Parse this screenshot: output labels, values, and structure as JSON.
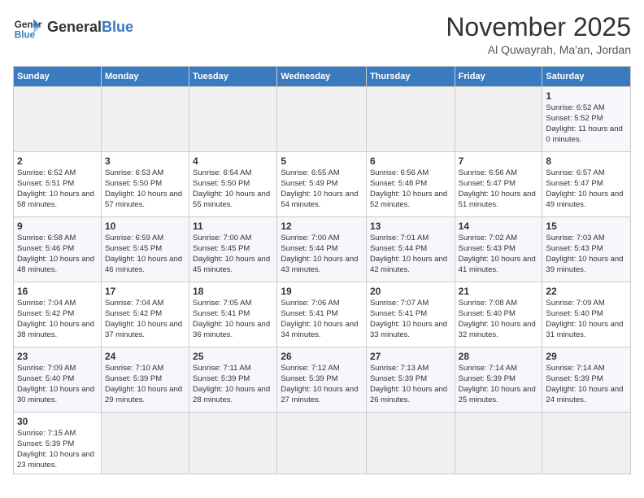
{
  "logo": {
    "text_general": "General",
    "text_blue": "Blue"
  },
  "header": {
    "month": "November 2025",
    "location": "Al Quwayrah, Ma'an, Jordan"
  },
  "weekdays": [
    "Sunday",
    "Monday",
    "Tuesday",
    "Wednesday",
    "Thursday",
    "Friday",
    "Saturday"
  ],
  "weeks": [
    [
      {
        "day": "",
        "info": ""
      },
      {
        "day": "",
        "info": ""
      },
      {
        "day": "",
        "info": ""
      },
      {
        "day": "",
        "info": ""
      },
      {
        "day": "",
        "info": ""
      },
      {
        "day": "",
        "info": ""
      },
      {
        "day": "1",
        "info": "Sunrise: 6:52 AM\nSunset: 5:52 PM\nDaylight: 11 hours and 0 minutes."
      }
    ],
    [
      {
        "day": "2",
        "info": "Sunrise: 6:52 AM\nSunset: 5:51 PM\nDaylight: 10 hours and 58 minutes."
      },
      {
        "day": "3",
        "info": "Sunrise: 6:53 AM\nSunset: 5:50 PM\nDaylight: 10 hours and 57 minutes."
      },
      {
        "day": "4",
        "info": "Sunrise: 6:54 AM\nSunset: 5:50 PM\nDaylight: 10 hours and 55 minutes."
      },
      {
        "day": "5",
        "info": "Sunrise: 6:55 AM\nSunset: 5:49 PM\nDaylight: 10 hours and 54 minutes."
      },
      {
        "day": "6",
        "info": "Sunrise: 6:56 AM\nSunset: 5:48 PM\nDaylight: 10 hours and 52 minutes."
      },
      {
        "day": "7",
        "info": "Sunrise: 6:56 AM\nSunset: 5:47 PM\nDaylight: 10 hours and 51 minutes."
      },
      {
        "day": "8",
        "info": "Sunrise: 6:57 AM\nSunset: 5:47 PM\nDaylight: 10 hours and 49 minutes."
      }
    ],
    [
      {
        "day": "9",
        "info": "Sunrise: 6:58 AM\nSunset: 5:46 PM\nDaylight: 10 hours and 48 minutes."
      },
      {
        "day": "10",
        "info": "Sunrise: 6:59 AM\nSunset: 5:45 PM\nDaylight: 10 hours and 46 minutes."
      },
      {
        "day": "11",
        "info": "Sunrise: 7:00 AM\nSunset: 5:45 PM\nDaylight: 10 hours and 45 minutes."
      },
      {
        "day": "12",
        "info": "Sunrise: 7:00 AM\nSunset: 5:44 PM\nDaylight: 10 hours and 43 minutes."
      },
      {
        "day": "13",
        "info": "Sunrise: 7:01 AM\nSunset: 5:44 PM\nDaylight: 10 hours and 42 minutes."
      },
      {
        "day": "14",
        "info": "Sunrise: 7:02 AM\nSunset: 5:43 PM\nDaylight: 10 hours and 41 minutes."
      },
      {
        "day": "15",
        "info": "Sunrise: 7:03 AM\nSunset: 5:43 PM\nDaylight: 10 hours and 39 minutes."
      }
    ],
    [
      {
        "day": "16",
        "info": "Sunrise: 7:04 AM\nSunset: 5:42 PM\nDaylight: 10 hours and 38 minutes."
      },
      {
        "day": "17",
        "info": "Sunrise: 7:04 AM\nSunset: 5:42 PM\nDaylight: 10 hours and 37 minutes."
      },
      {
        "day": "18",
        "info": "Sunrise: 7:05 AM\nSunset: 5:41 PM\nDaylight: 10 hours and 36 minutes."
      },
      {
        "day": "19",
        "info": "Sunrise: 7:06 AM\nSunset: 5:41 PM\nDaylight: 10 hours and 34 minutes."
      },
      {
        "day": "20",
        "info": "Sunrise: 7:07 AM\nSunset: 5:41 PM\nDaylight: 10 hours and 33 minutes."
      },
      {
        "day": "21",
        "info": "Sunrise: 7:08 AM\nSunset: 5:40 PM\nDaylight: 10 hours and 32 minutes."
      },
      {
        "day": "22",
        "info": "Sunrise: 7:09 AM\nSunset: 5:40 PM\nDaylight: 10 hours and 31 minutes."
      }
    ],
    [
      {
        "day": "23",
        "info": "Sunrise: 7:09 AM\nSunset: 5:40 PM\nDaylight: 10 hours and 30 minutes."
      },
      {
        "day": "24",
        "info": "Sunrise: 7:10 AM\nSunset: 5:39 PM\nDaylight: 10 hours and 29 minutes."
      },
      {
        "day": "25",
        "info": "Sunrise: 7:11 AM\nSunset: 5:39 PM\nDaylight: 10 hours and 28 minutes."
      },
      {
        "day": "26",
        "info": "Sunrise: 7:12 AM\nSunset: 5:39 PM\nDaylight: 10 hours and 27 minutes."
      },
      {
        "day": "27",
        "info": "Sunrise: 7:13 AM\nSunset: 5:39 PM\nDaylight: 10 hours and 26 minutes."
      },
      {
        "day": "28",
        "info": "Sunrise: 7:14 AM\nSunset: 5:39 PM\nDaylight: 10 hours and 25 minutes."
      },
      {
        "day": "29",
        "info": "Sunrise: 7:14 AM\nSunset: 5:39 PM\nDaylight: 10 hours and 24 minutes."
      }
    ],
    [
      {
        "day": "30",
        "info": "Sunrise: 7:15 AM\nSunset: 5:39 PM\nDaylight: 10 hours and 23 minutes."
      },
      {
        "day": "",
        "info": ""
      },
      {
        "day": "",
        "info": ""
      },
      {
        "day": "",
        "info": ""
      },
      {
        "day": "",
        "info": ""
      },
      {
        "day": "",
        "info": ""
      },
      {
        "day": "",
        "info": ""
      }
    ]
  ]
}
